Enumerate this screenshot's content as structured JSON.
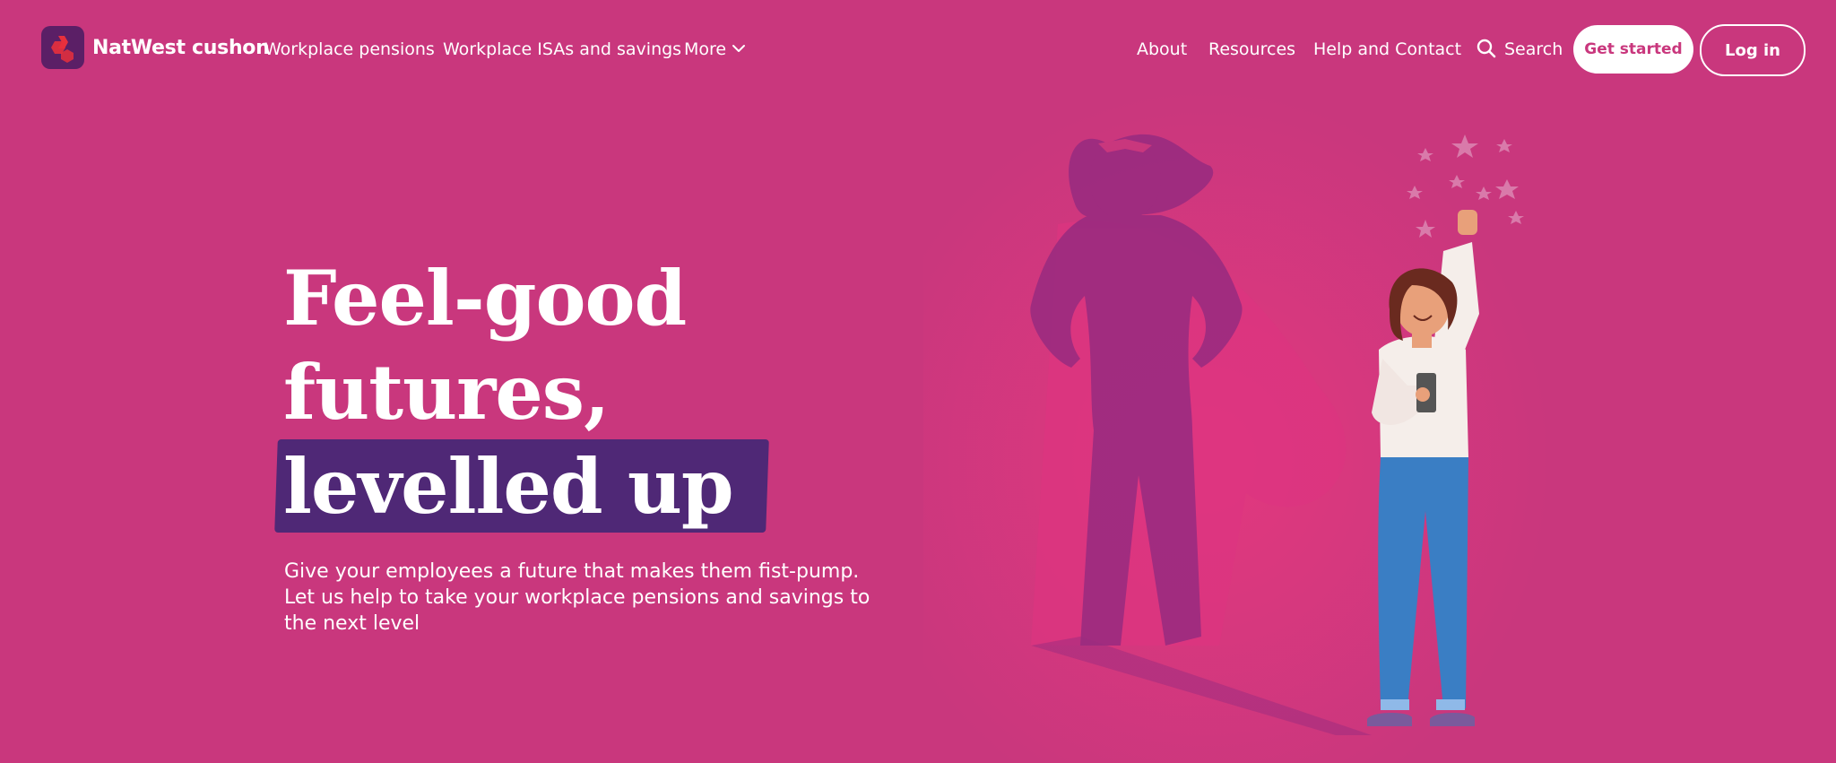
{
  "header": {
    "brand": "NatWest cushon",
    "nav": {
      "workplace_pensions": "Workplace pensions",
      "workplace_isas": "Workplace ISAs and savings",
      "more": "More",
      "about": "About",
      "resources": "Resources",
      "help": "Help and Contact",
      "search": "Search"
    },
    "get_started": "Get started",
    "log_in": "Log in"
  },
  "hero": {
    "headline_line1": "Feel-good",
    "headline_line2": "futures,",
    "headline_line3": "levelled up",
    "subcopy": "Give your employees a future that makes them fist-pump. Let us help to take your workplace pensions and savings to the next level"
  },
  "colors": {
    "background": "#c9377d",
    "highlight": "#4f2876",
    "button_text": "#c9377d"
  },
  "icons": {
    "logo": "natwest-cushon-logo-icon",
    "more": "chevron-down-icon",
    "search": "search-icon"
  }
}
